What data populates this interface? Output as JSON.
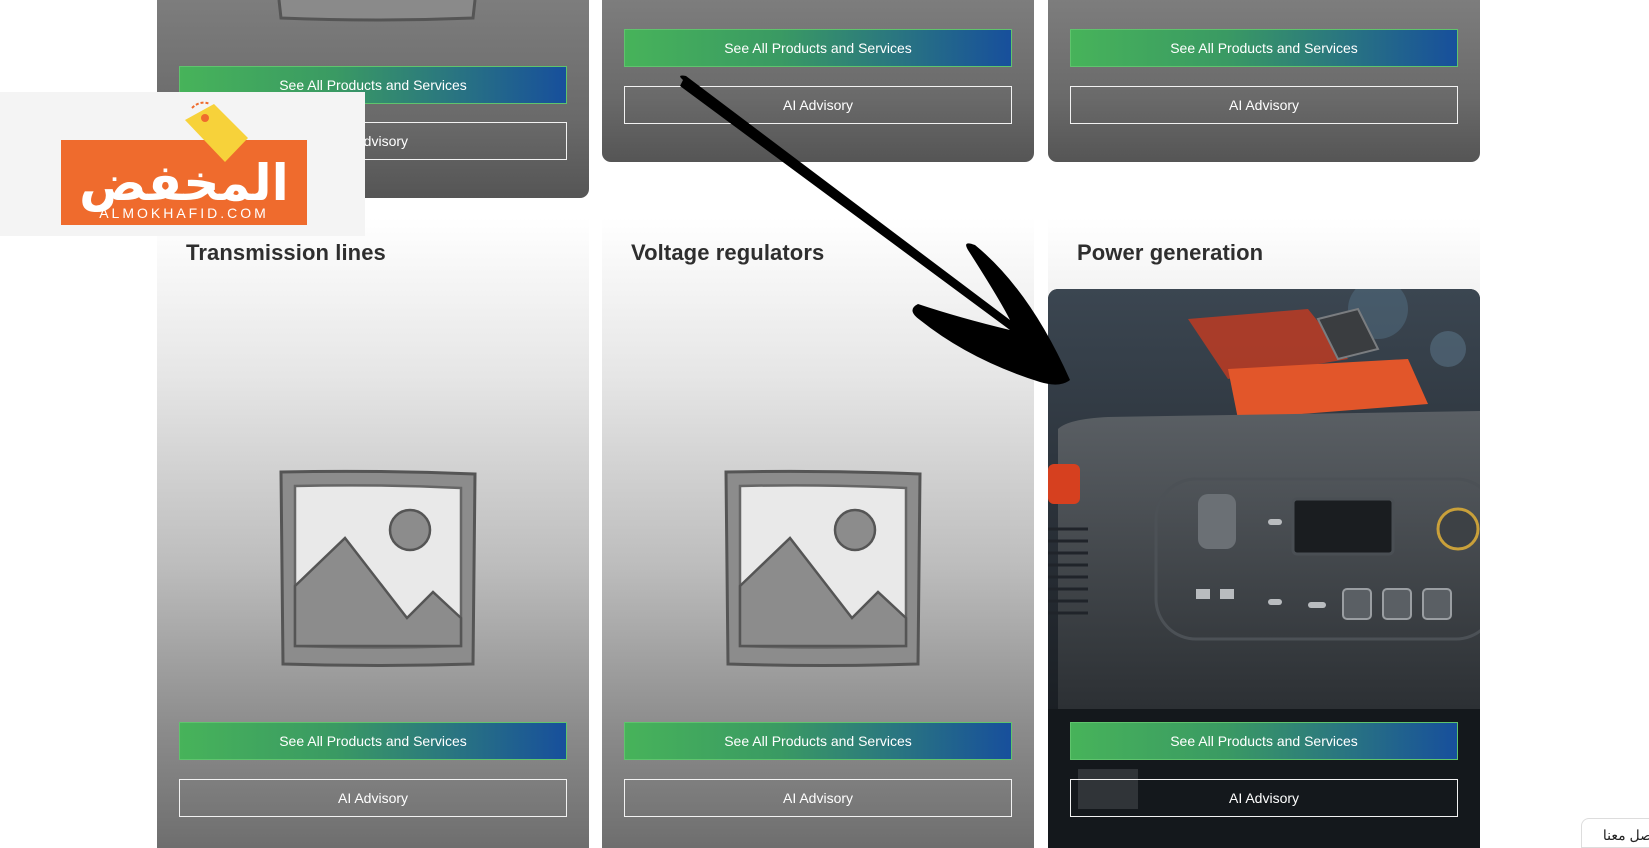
{
  "cards_top": [
    {
      "primary_label": "See All Products and Services",
      "secondary_label": "AI Advisory"
    },
    {
      "primary_label": "See All Products and Services",
      "secondary_label": "AI Advisory"
    },
    {
      "primary_label": "See All Products and Services",
      "secondary_label": "AI Advisory"
    }
  ],
  "cards_bottom": [
    {
      "title": "Transmission lines",
      "image": "placeholder-image-icon",
      "primary_label": "See All Products and Services",
      "secondary_label": "AI Advisory"
    },
    {
      "title": "Voltage regulators",
      "image": "placeholder-image-icon",
      "primary_label": "See All Products and Services",
      "secondary_label": "AI Advisory"
    },
    {
      "title": "Power generation",
      "image": "portable-power-station-photo",
      "primary_label": "See All Products and Services",
      "secondary_label": "AI Advisory"
    }
  ],
  "watermark": {
    "brand_text": "المخفض",
    "domain_text": "ALMOKHAFID.COM",
    "colors": {
      "orange": "#ef6b2d",
      "yellow": "#f7d23a"
    }
  },
  "contact_tab": {
    "label": "اتصل معنا"
  },
  "colors": {
    "primary_gradient_start": "#47b35a",
    "primary_gradient_end": "#174f9c",
    "card_dark": "#6a6a6a",
    "title_text": "#2e2e2e"
  }
}
